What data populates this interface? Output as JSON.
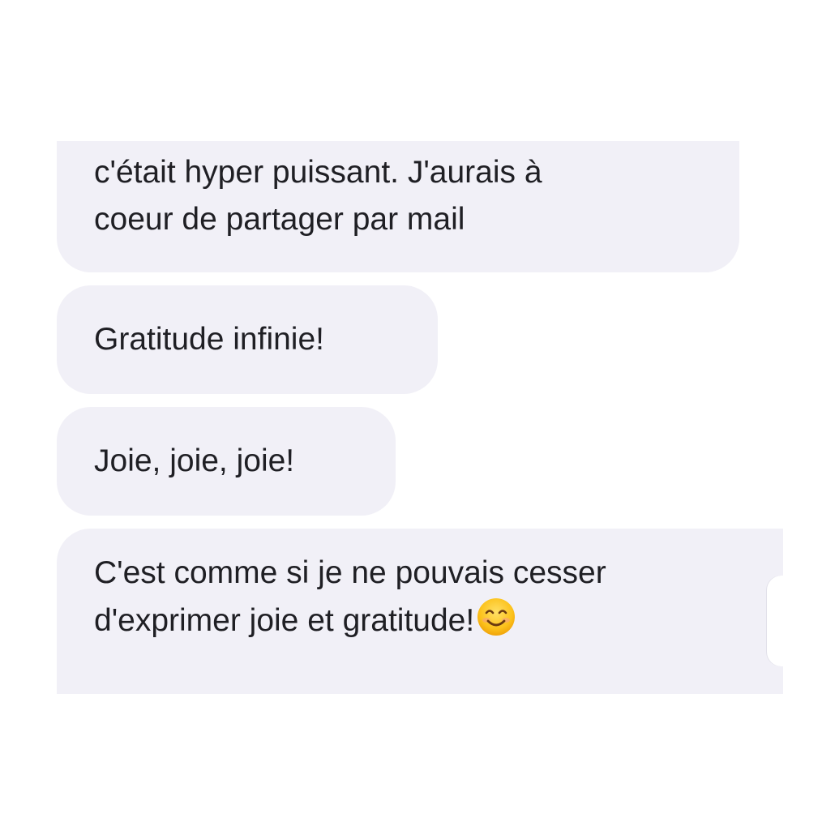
{
  "conversation": {
    "messages": [
      {
        "lines": [
          "c'était hyper puissant. J'aurais à",
          "coeur de partager par mail"
        ]
      },
      {
        "lines": [
          "Gratitude infinie!"
        ]
      },
      {
        "lines": [
          "Joie, joie, joie!"
        ]
      },
      {
        "lines": [
          "C'est comme si je ne pouvais cesser",
          "d'exprimer joie et gratitude!"
        ],
        "trailing_icon": "smiling-face-emoji"
      }
    ]
  },
  "colors": {
    "bubble_background": "#f1f0f7",
    "text": "#1f1f24",
    "page_background": "#ffffff"
  }
}
